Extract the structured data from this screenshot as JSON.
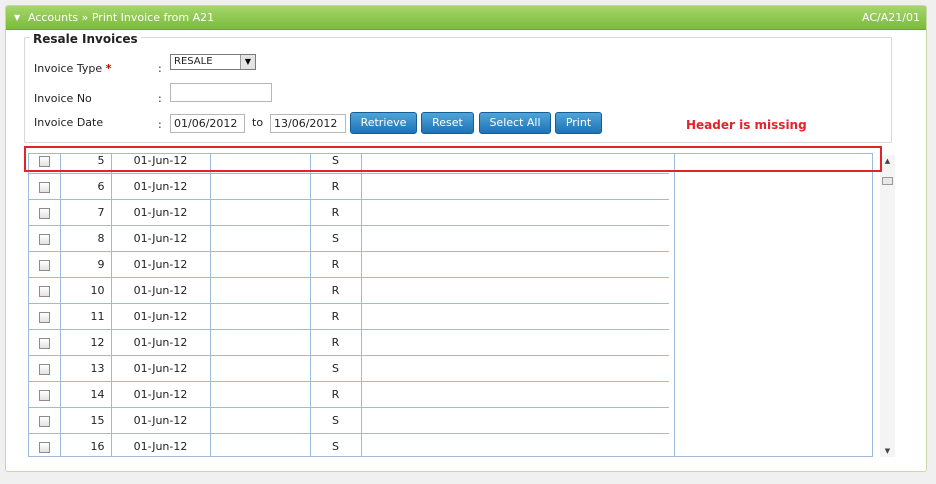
{
  "titlebar": {
    "breadcrumb": "Accounts » Print Invoice from A21",
    "screen_code": "AC/A21/01"
  },
  "section": {
    "legend": "Resale Invoices"
  },
  "form": {
    "invoice_type_label": "Invoice Type",
    "required_mark": "*",
    "invoice_type_value": "RESALE",
    "invoice_no_label": "Invoice No",
    "invoice_no_value": "",
    "invoice_date_label": "Invoice Date",
    "colon": ":",
    "date_from": "01/06/2012",
    "to_label": "to",
    "date_to": "13/06/2012"
  },
  "buttons": {
    "retrieve": "Retrieve",
    "reset": "Reset",
    "select_all": "Select All",
    "print": "Print"
  },
  "annotation": {
    "text": "Header is missing",
    "color": "#e0242a"
  },
  "colors": {
    "title_bar": "#8cc54e",
    "button": "#2a82c4",
    "grid_line": "#9ebbd6"
  },
  "rows": [
    {
      "num": "5",
      "date": "01-Jun-12",
      "type": "S"
    },
    {
      "num": "6",
      "date": "01-Jun-12",
      "type": "R"
    },
    {
      "num": "7",
      "date": "01-Jun-12",
      "type": "R"
    },
    {
      "num": "8",
      "date": "01-Jun-12",
      "type": "S"
    },
    {
      "num": "9",
      "date": "01-Jun-12",
      "type": "R"
    },
    {
      "num": "10",
      "date": "01-Jun-12",
      "type": "R"
    },
    {
      "num": "11",
      "date": "01-Jun-12",
      "type": "R"
    },
    {
      "num": "12",
      "date": "01-Jun-12",
      "type": "R"
    },
    {
      "num": "13",
      "date": "01-Jun-12",
      "type": "S"
    },
    {
      "num": "14",
      "date": "01-Jun-12",
      "type": "R"
    },
    {
      "num": "15",
      "date": "01-Jun-12",
      "type": "S"
    },
    {
      "num": "16",
      "date": "01-Jun-12",
      "type": "S"
    }
  ]
}
